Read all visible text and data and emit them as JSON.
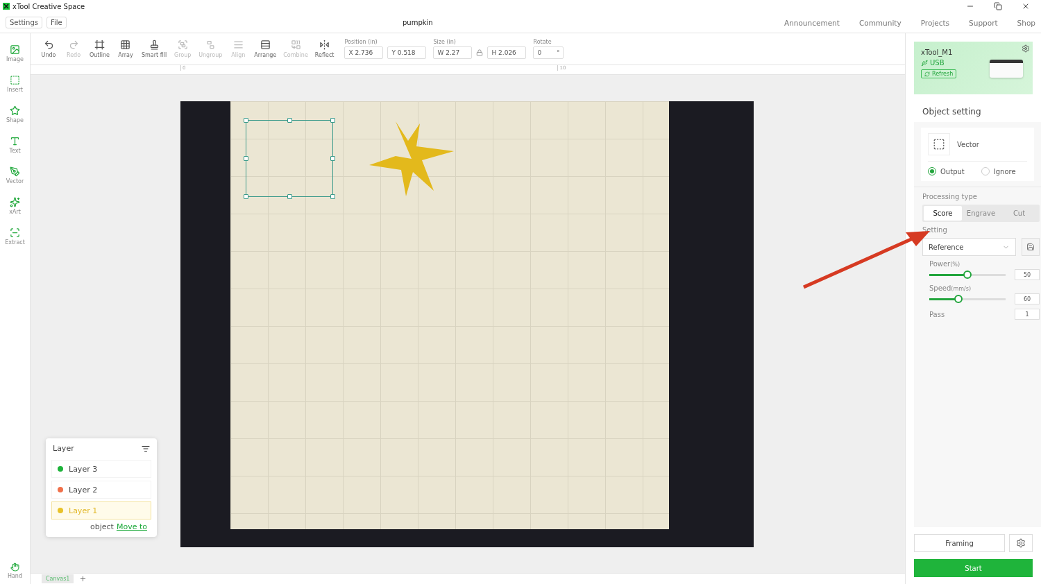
{
  "window": {
    "title": "xTool Creative Space"
  },
  "menu": {
    "buttons": [
      "Settings",
      "File"
    ],
    "document": "pumpkin",
    "links": [
      "Announcement",
      "Community",
      "Projects",
      "Support",
      "Shop"
    ]
  },
  "tools": [
    {
      "label": "Image"
    },
    {
      "label": "Insert"
    },
    {
      "label": "Shape"
    },
    {
      "label": "Text"
    },
    {
      "label": "Vector"
    },
    {
      "label": "xArt"
    },
    {
      "label": "Extract"
    }
  ],
  "hand_tool": {
    "label": "Hand"
  },
  "toolbar": [
    {
      "label": "Undo",
      "disabled": false
    },
    {
      "label": "Redo",
      "disabled": true
    },
    {
      "label": "Outline",
      "disabled": false
    },
    {
      "label": "Array",
      "disabled": false
    },
    {
      "label": "Smart fill",
      "disabled": false
    },
    {
      "label": "Group",
      "disabled": true
    },
    {
      "label": "Ungroup",
      "disabled": true
    },
    {
      "label": "Align",
      "disabled": true
    },
    {
      "label": "Arrange",
      "disabled": false
    },
    {
      "label": "Combine",
      "disabled": true
    },
    {
      "label": "Reflect",
      "disabled": false
    }
  ],
  "position": {
    "label": "Position (in)",
    "x": "X 2.736",
    "y": "Y 0.518"
  },
  "size": {
    "label": "Size (in)",
    "w": "W 2.27",
    "h": "H 2.026"
  },
  "rotate": {
    "label": "Rotate",
    "value": "0",
    "unit": "°"
  },
  "ruler": {
    "marks": [
      "0",
      "10"
    ]
  },
  "layers": {
    "title": "Layer",
    "items": [
      {
        "name": "Layer 3",
        "color": "#1db33a",
        "selected": false
      },
      {
        "name": "Layer 2",
        "color": "#f0704a",
        "selected": false
      },
      {
        "name": "Layer 1",
        "color": "#e8c22a",
        "selected": true
      }
    ],
    "footer": "object",
    "link": "Move to"
  },
  "canvas_tabs": [
    {
      "label": "Canvas1",
      "selected": true
    }
  ],
  "device": {
    "name": "xTool_M1",
    "connection": "USB",
    "refresh": "Refresh"
  },
  "object_setting": {
    "title": "Object setting",
    "type": "Vector",
    "modes": [
      {
        "label": "Output",
        "selected": true
      },
      {
        "label": "Ignore",
        "selected": false
      }
    ],
    "processing_label": "Processing type",
    "processing": [
      {
        "label": "Score",
        "selected": true
      },
      {
        "label": "Engrave",
        "selected": false
      },
      {
        "label": "Cut",
        "selected": false
      }
    ],
    "setting_label": "Setting",
    "setting": "Reference",
    "params": [
      {
        "kind": "slider",
        "label": "Power",
        "unit": "(%)",
        "level": 0.5,
        "value": "50"
      },
      {
        "kind": "slider",
        "label": "Speed",
        "unit": "(mm/s)",
        "level": 0.38,
        "value": "60"
      },
      {
        "kind": "number",
        "label": "Pass",
        "value": "1"
      }
    ]
  },
  "actions": {
    "framing": "Framing",
    "start": "Start"
  }
}
